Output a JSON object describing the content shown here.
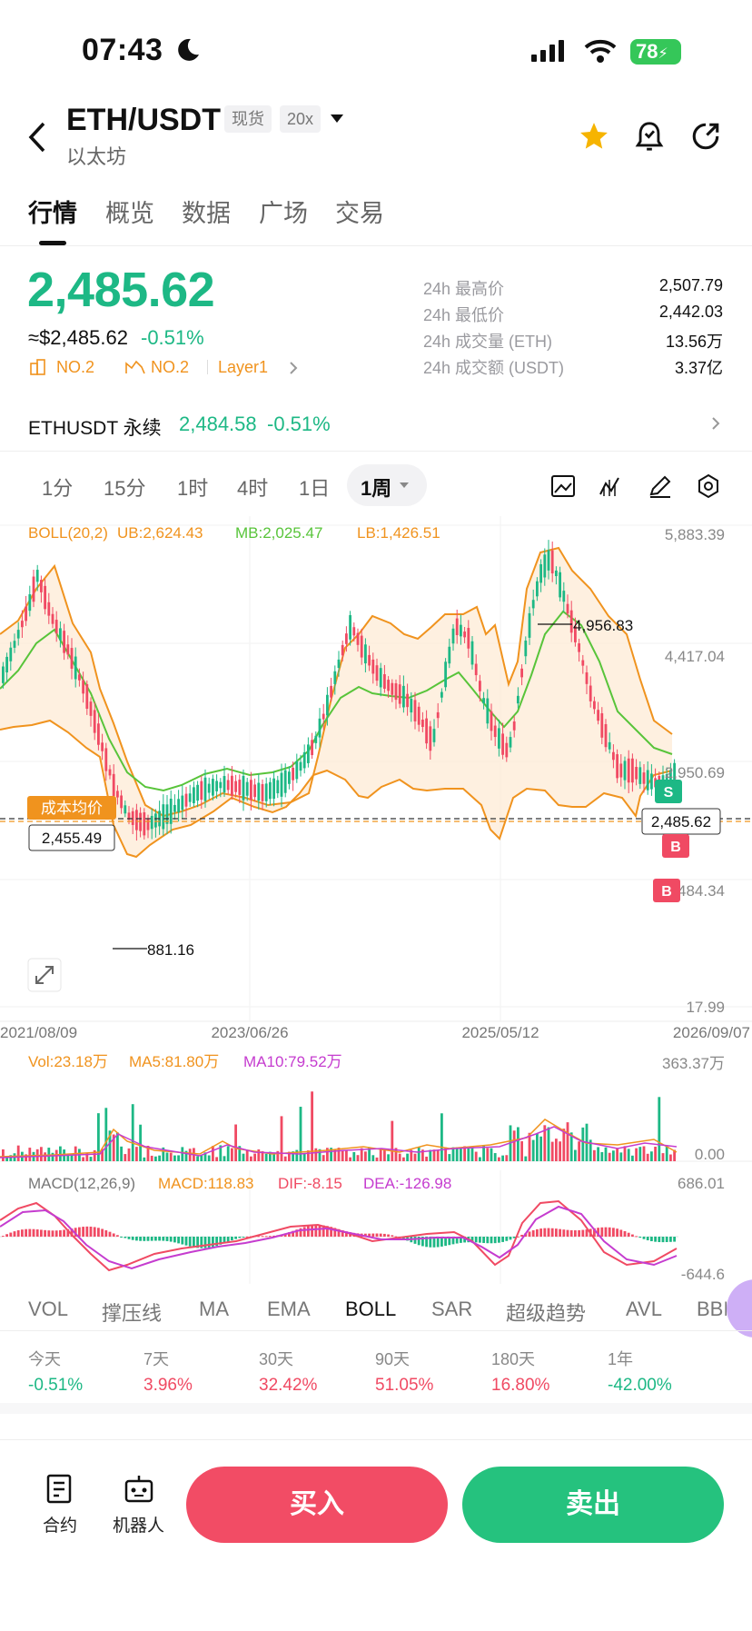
{
  "status": {
    "time": "07:43",
    "battery": "78"
  },
  "header": {
    "pair": "ETH/USDT",
    "tag_spot": "现货",
    "tag_leverage": "20x",
    "subtitle": "以太坊"
  },
  "tabs": [
    "行情",
    "概览",
    "数据",
    "广场",
    "交易"
  ],
  "price": {
    "last": "2,485.62",
    "usd": "≈$2,485.62",
    "change": "-0.51%",
    "rank1": "NO.2",
    "rank2": "NO.2",
    "layer": "Layer1"
  },
  "stats": [
    {
      "label": "24h 最高价",
      "value": "2,507.79"
    },
    {
      "label": "24h 最低价",
      "value": "2,442.03"
    },
    {
      "label": "24h 成交量 (ETH)",
      "value": "13.56万"
    },
    {
      "label": "24h 成交额 (USDT)",
      "value": "3.37亿"
    }
  ],
  "perp": {
    "name": "ETHUSDT 永续",
    "price": "2,484.58",
    "change": "-0.51%"
  },
  "timeframes": [
    "1分",
    "15分",
    "1时",
    "4时",
    "1日",
    "1周"
  ],
  "chart": {
    "boll_label": "BOLL(20,2)",
    "ub": "UB:2,624.43",
    "mb": "MB:2,025.47",
    "lb": "LB:1,426.51",
    "y_ticks": [
      "5,883.39",
      "4,417.04",
      "2,950.69",
      "1,484.34",
      "17.99"
    ],
    "dates": [
      "2021/08/09",
      "2023/06/26",
      "2025/05/12",
      "2026/09/07"
    ],
    "high_mark": "4,956.83",
    "low_mark": "881.16",
    "cost_label": "成本均价",
    "cost_value": "2,455.49",
    "current_price_tag": "2,485.62",
    "sell_marker": "S",
    "buy_marker": "B",
    "vol_label": "Vol:23.18万",
    "ma5": "MA5:81.80万",
    "ma10": "MA10:79.52万",
    "vol_max": "363.37万",
    "vol_min": "0.00",
    "macd_label": "MACD(12,26,9)",
    "macd_val": "MACD:118.83",
    "dif": "DIF:-8.15",
    "dea": "DEA:-126.98",
    "macd_max": "686.01",
    "macd_min": "-644.6"
  },
  "indicators": [
    "VOL",
    "撑压线",
    "MA",
    "EMA",
    "BOLL",
    "SAR",
    "超级趋势",
    "AVL",
    "BBI"
  ],
  "periods": [
    {
      "label": "今天",
      "value": "-0.51%"
    },
    {
      "label": "7天",
      "value": "3.96%"
    },
    {
      "label": "30天",
      "value": "32.42%"
    },
    {
      "label": "90天",
      "value": "51.05%"
    },
    {
      "label": "180天",
      "value": "16.80%"
    },
    {
      "label": "1年",
      "value": "-42.00%"
    }
  ],
  "bottom": {
    "contract": "合约",
    "robot": "机器人",
    "buy": "买入",
    "sell": "卖出"
  },
  "colors": {
    "up": "#1db885",
    "down": "#f04a63",
    "boll": "#f0931e",
    "mb": "#58c43a",
    "dea": "#c53ccf"
  }
}
